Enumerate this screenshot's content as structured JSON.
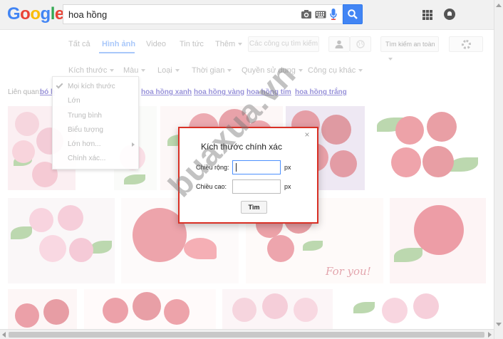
{
  "search": {
    "query": "hoa hồng"
  },
  "brand": {
    "logo_letters": [
      "G",
      "o",
      "o",
      "g",
      "l",
      "e"
    ],
    "logo_colors": [
      "#4285f4",
      "#ea4335",
      "#fbbc05",
      "#4285f4",
      "#34a853",
      "#ea4335"
    ]
  },
  "tabs": [
    {
      "label": "Tất cả"
    },
    {
      "label": "Hình ảnh"
    },
    {
      "label": "Video"
    },
    {
      "label": "Tin tức"
    },
    {
      "label": "Thêm"
    }
  ],
  "tools": {
    "search_tools_label": "Các công cụ tìm kiếm",
    "safe_search_label": "Tìm kiếm an toàn"
  },
  "filters": [
    {
      "label": "Kích thước"
    },
    {
      "label": "Màu"
    },
    {
      "label": "Loại"
    },
    {
      "label": "Thời gian"
    },
    {
      "label": "Quyền sử dụng"
    },
    {
      "label": "Công cụ khác"
    }
  ],
  "related": {
    "label": "Liên quan:",
    "links": [
      {
        "text": "bó h"
      },
      {
        "text": "hoa hồng xanh"
      },
      {
        "text": "hoa hồng vàng"
      },
      {
        "text": "hoa hồng tím"
      },
      {
        "text": "hoa hồng trắng"
      }
    ]
  },
  "size_dropdown": {
    "items": [
      {
        "label": "Mọi kích thước",
        "checked": true
      },
      {
        "label": "Lớn"
      },
      {
        "label": "Trung bình"
      },
      {
        "label": "Biểu tượng"
      },
      {
        "label": "Lớn hơn..."
      },
      {
        "label": "Chính xác..."
      }
    ]
  },
  "exact_size_dialog": {
    "close": "×",
    "title": "Kích thước chính xác",
    "width_label": "Chiều rộng:",
    "width_value": "",
    "height_label": "Chiều cao:",
    "height_value": "",
    "unit": "px",
    "submit_label": "Tìm"
  },
  "image_caption": "For you!",
  "watermark": "buaxua.vn",
  "colors": {
    "accent": "#4285f4",
    "dialog_border": "#d93025",
    "link": "#1a0dab"
  }
}
